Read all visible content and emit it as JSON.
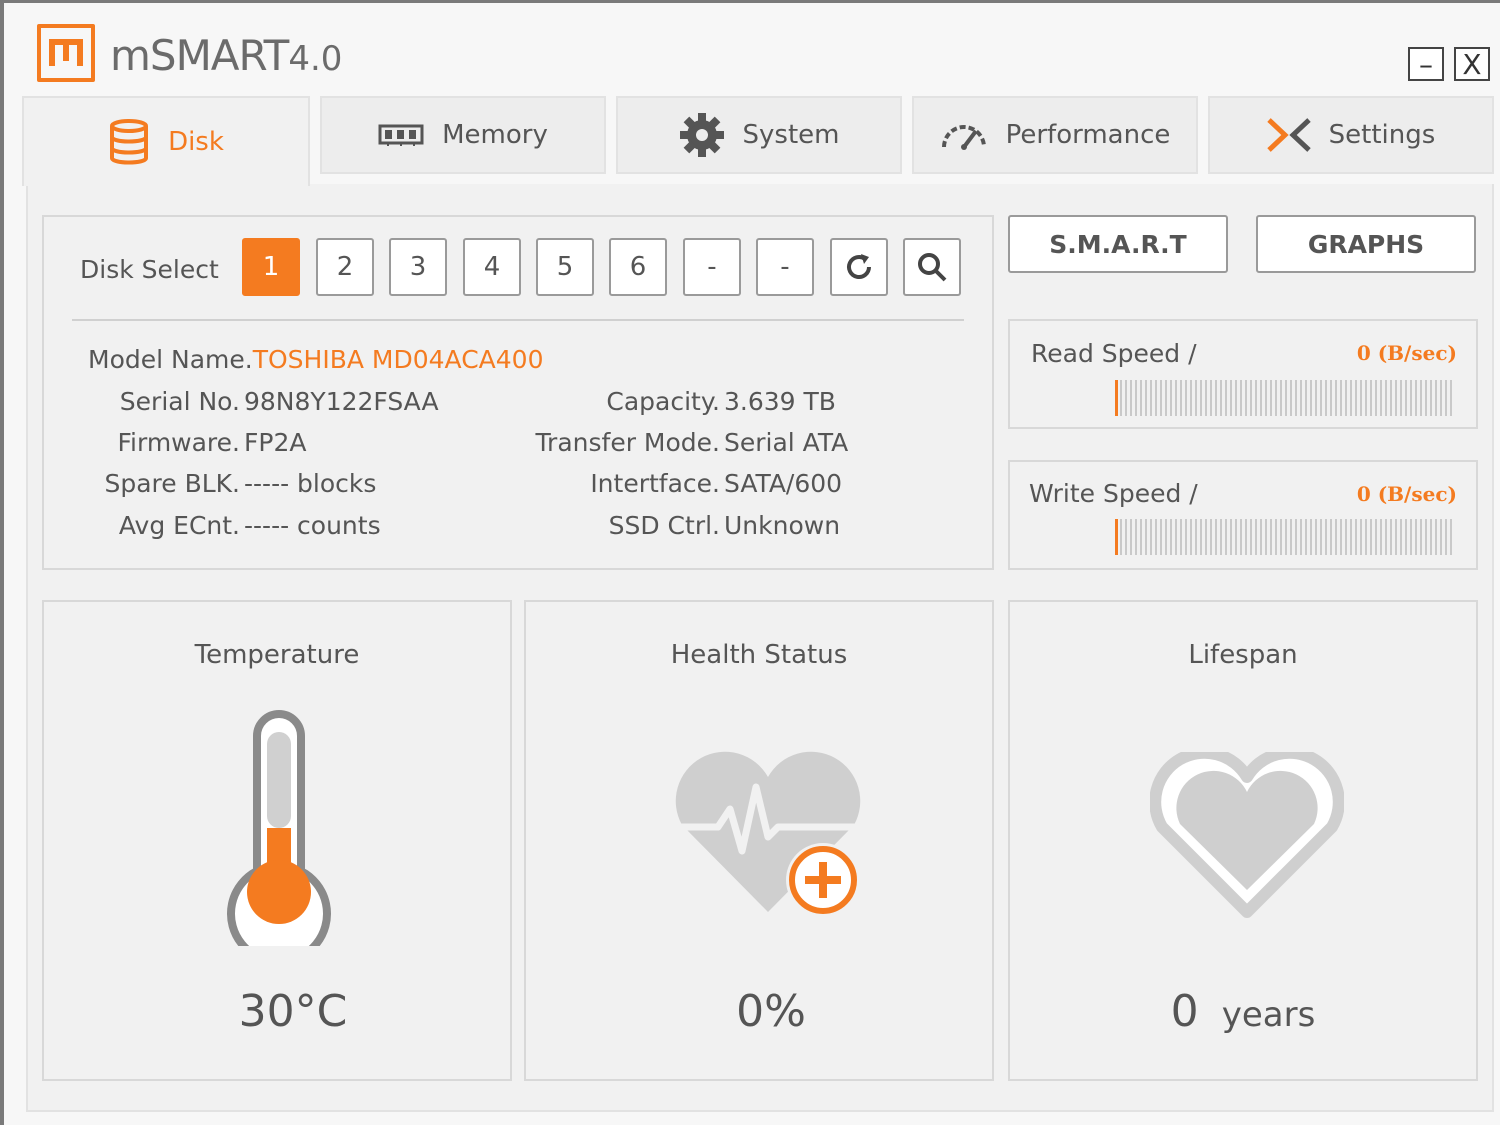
{
  "app": {
    "title": "mSMART",
    "version": "4.0",
    "logo_letter": "m"
  },
  "window_controls": {
    "minimize": "–",
    "close": "X"
  },
  "tabs": [
    {
      "label": "Disk",
      "icon": "database-icon",
      "active": true
    },
    {
      "label": "Memory",
      "icon": "memory-chip-icon",
      "active": false
    },
    {
      "label": "System",
      "icon": "gear-icon",
      "active": false
    },
    {
      "label": "Performance",
      "icon": "speedometer-icon",
      "active": false
    },
    {
      "label": "Settings",
      "icon": "settings-x-icon",
      "active": false
    }
  ],
  "disk_select": {
    "label": "Disk Select",
    "buttons": [
      "1",
      "2",
      "3",
      "4",
      "5",
      "6",
      "-",
      "-"
    ],
    "selected": "1"
  },
  "disk_info": {
    "model_label": "Model Name.",
    "model_value": "TOSHIBA MD04ACA400",
    "serial_label": "Serial No.",
    "serial_value": "98N8Y122FSAA",
    "firmware_label": "Firmware.",
    "firmware_value": "FP2A",
    "spare_label": "Spare BLK.",
    "spare_value": "----- blocks",
    "avg_label": "Avg ECnt.",
    "avg_value": "----- counts",
    "capacity_label": "Capacity.",
    "capacity_value": "3.639 TB",
    "transfer_label": "Transfer Mode.",
    "transfer_value": "Serial ATA",
    "interface_label": "Intertface.",
    "interface_value": "SATA/600",
    "ssd_label": "SSD Ctrl.",
    "ssd_value": "Unknown"
  },
  "actions": {
    "smart": "S.M.A.R.T",
    "graphs": "GRAPHS"
  },
  "speeds": {
    "read_label": "Read Speed /",
    "read_value": "0 (B/sec)",
    "read_level": 0,
    "write_label": "Write Speed /",
    "write_value": "0 (B/sec)",
    "write_level": 0
  },
  "cards": {
    "temperature_title": "Temperature",
    "temperature_value": "30°C",
    "health_title": "Health Status",
    "health_value": "0%",
    "lifespan_title": "Lifespan",
    "lifespan_number": "0",
    "lifespan_unit": "years"
  },
  "colors": {
    "accent": "#f47b20",
    "text": "#555555",
    "icon_gray": "#cfcfcf"
  }
}
